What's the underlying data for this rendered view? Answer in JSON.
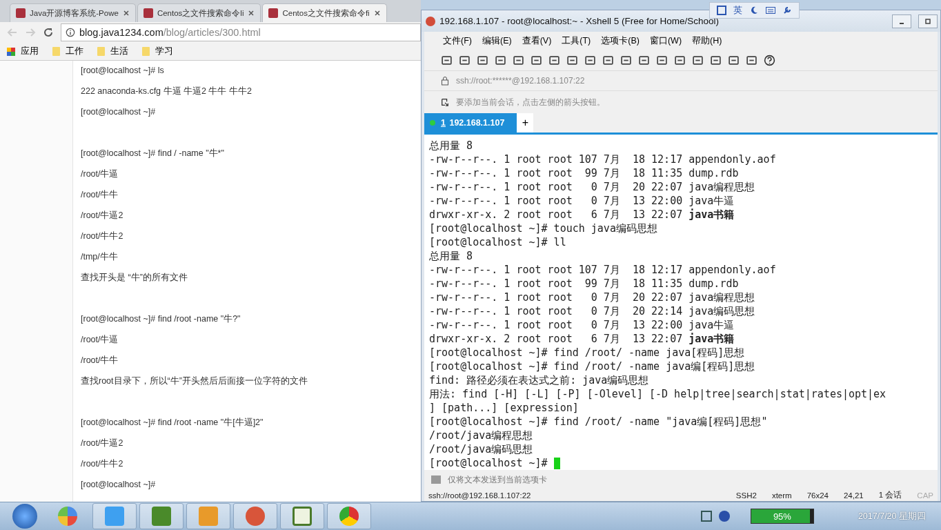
{
  "browser": {
    "tabs": [
      {
        "title": "Java开源博客系统-Powe",
        "selected": false
      },
      {
        "title": "Centos之文件搜索命令li",
        "selected": false
      },
      {
        "title": "Centos之文件搜索命令fi",
        "selected": true
      }
    ],
    "url": {
      "host": "blog.java1234.com",
      "path": "/blog/articles/300.html"
    },
    "bookmarks": [
      "应用",
      "工作",
      "生活",
      "学习"
    ],
    "article_blocks": [
      [
        "[root@localhost ~]# ls",
        "222  anaconda-ks.cfg  牛逼  牛逼2  牛牛  牛牛2",
        "[root@localhost ~]#"
      ],
      [
        "[root@localhost ~]# find / -name \"牛*\"",
        "/root/牛逼",
        "/root/牛牛",
        "/root/牛逼2",
        "/root/牛牛2",
        "/tmp/牛牛",
        "查找开头是 “牛”的所有文件"
      ],
      [
        "[root@localhost ~]# find /root -name \"牛?\"",
        "/root/牛逼",
        "/root/牛牛",
        "查找root目录下，所以“牛”开头然后后面接一位字符的文件"
      ],
      [
        "[root@localhost ~]# find /root -name \"牛[牛逼]2\"",
        "/root/牛逼2",
        "/root/牛牛2",
        "[root@localhost ~]#"
      ]
    ]
  },
  "ime_bar": {
    "label": "英"
  },
  "xshell": {
    "title": "192.168.1.107 - root@localhost:~ - Xshell 5 (Free for Home/School)",
    "menu": [
      "文件(F)",
      "编辑(E)",
      "查看(V)",
      "工具(T)",
      "选项卡(B)",
      "窗口(W)",
      "帮助(H)"
    ],
    "address": "ssh://root:******@192.168.1.107:22",
    "hint": "要添加当前会话，点击左侧的箭头按钮。",
    "session_tabs": [
      {
        "number": "1",
        "host": "192.168.1.107",
        "selected": true,
        "connected": true
      }
    ],
    "new_tab": "+",
    "terminal_lines": [
      "总用量 8",
      "-rw-r--r--. 1 root root 107 7月  18 12:17 appendonly.aof",
      "-rw-r--r--. 1 root root  99 7月  18 11:35 dump.rdb",
      "-rw-r--r--. 1 root root   0 7月  20 22:07 java编程思想",
      "-rw-r--r--. 1 root root   0 7月  13 22:00 java牛逼",
      "drwxr-xr-x. 2 root root   6 7月  13 22:07 **java书籍**",
      "[root@localhost ~]# touch java编码思想",
      "[root@localhost ~]# ll",
      "总用量 8",
      "-rw-r--r--. 1 root root 107 7月  18 12:17 appendonly.aof",
      "-rw-r--r--. 1 root root  99 7月  18 11:35 dump.rdb",
      "-rw-r--r--. 1 root root   0 7月  20 22:07 java编程思想",
      "-rw-r--r--. 1 root root   0 7月  20 22:14 java编码思想",
      "-rw-r--r--. 1 root root   0 7月  13 22:00 java牛逼",
      "drwxr-xr-x. 2 root root   6 7月  13 22:07 **java书籍**",
      "[root@localhost ~]# find /root/ -name java[程码]思想",
      "[root@localhost ~]# find /root/ -name java编[程码]思想",
      "find: 路径必须在表达式之前: java编码思想",
      "用法: find [-H] [-L] [-P] [-Olevel] [-D help|tree|search|stat|rates|opt|ex",
      "] [path...] [expression]",
      "[root@localhost ~]# find /root/ -name \"java编[程码]思想\"",
      "/root/java编程思想",
      "/root/java编码思想",
      "[root@localhost ~]# "
    ],
    "compose_placeholder": "仅将文本发送到当前选项卡",
    "status_bar": {
      "connection": "ssh://root@192.168.1.107:22",
      "protocol": "SSH2",
      "terminal": "xterm",
      "size": "76x24",
      "cursor": "24,21",
      "sessions": "1 会话",
      "caps": "CAP"
    }
  },
  "taskbar": {
    "battery": {
      "label": "95%",
      "level": 0.95
    },
    "date": "2017/7/20 星期四"
  }
}
